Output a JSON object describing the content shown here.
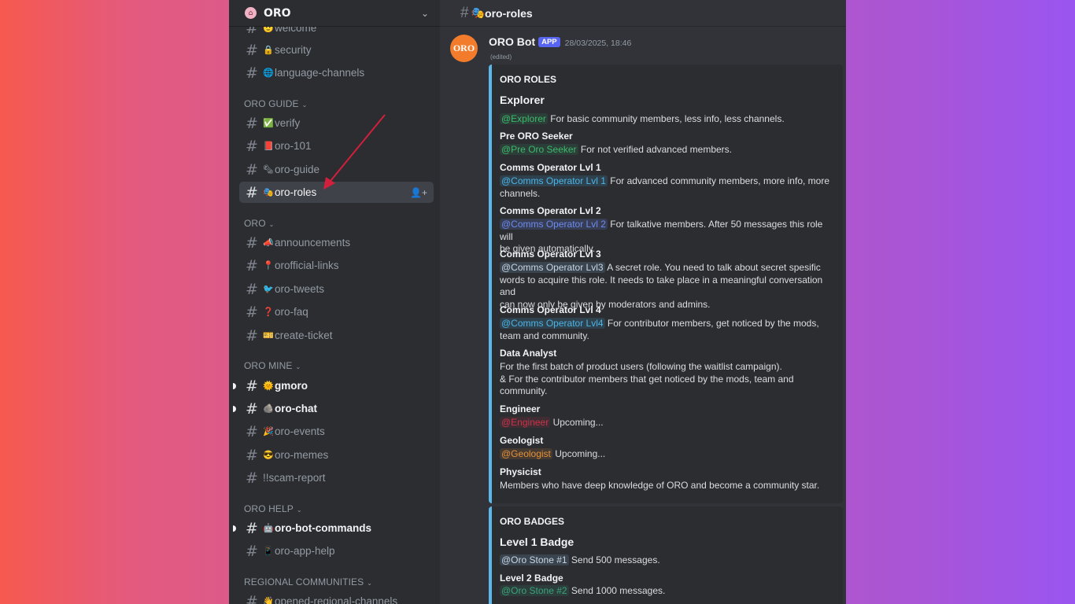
{
  "server": {
    "name": "ORO",
    "icon": "home-icon"
  },
  "sidebar": {
    "categories": [
      {
        "label": "ORO GUIDE"
      },
      {
        "label": "ORO"
      },
      {
        "label": "ORO MINE"
      },
      {
        "label": "ORO HELP"
      },
      {
        "label": "REGIONAL COMMUNITIES"
      }
    ],
    "channels": [
      {
        "emoji": "🫡",
        "name": "welcome"
      },
      {
        "emoji": "🔒",
        "name": "security"
      },
      {
        "emoji": "🌐",
        "name": "language-channels"
      },
      {
        "emoji": "✅",
        "name": "verify"
      },
      {
        "emoji": "📕",
        "name": "oro-101"
      },
      {
        "emoji": "🗞",
        "name": "oro-guide"
      },
      {
        "emoji": "🎭",
        "name": "oro-roles"
      },
      {
        "emoji": "📣",
        "name": "announcements"
      },
      {
        "emoji": "📍",
        "name": "orofficial-links"
      },
      {
        "emoji": "🐦",
        "name": "oro-tweets"
      },
      {
        "emoji": "❓",
        "name": "oro-faq"
      },
      {
        "emoji": "🎫",
        "name": "create-ticket"
      },
      {
        "emoji": "🌞",
        "name": "gmoro"
      },
      {
        "emoji": "🪨",
        "name": "oro-chat"
      },
      {
        "emoji": "🎉",
        "name": "oro-events"
      },
      {
        "emoji": "😎",
        "name": "oro-memes"
      },
      {
        "emoji": "",
        "name": "!!scam-report"
      },
      {
        "emoji": "🤖",
        "name": "oro-bot-commands"
      },
      {
        "emoji": "📱",
        "name": "oro-app-help"
      },
      {
        "emoji": "👋",
        "name": "opened-regional-channels"
      }
    ]
  },
  "header": {
    "channel": "oro-roles",
    "emoji": "🎭"
  },
  "message": {
    "author": "ORO Bot",
    "tag": "APP",
    "time": "28/03/2025, 18:46",
    "edited": "(edited)",
    "avatar_text": "ORO"
  },
  "roles_embed": {
    "title": "ORO ROLES",
    "explorer_h": "Explorer",
    "explorer_m": "@Explorer",
    "explorer_t": "For basic community members, less info, less channels.",
    "pre_h": "Pre ORO Seeker",
    "pre_m": "@Pre Oro Seeker",
    "pre_t": "For not verified advanced members.",
    "c1_h": "Comms Operator Lvl 1",
    "c1_m": "@Comms Operator Lvl 1",
    "c1_t": "For advanced community members, more info, more",
    "c1_t2": "channels.",
    "c2_h": "Comms Operator Lvl 2",
    "c2_m": "@Comms Operator Lvl 2",
    "c2_t": "For talkative members. After 50 messages this role will",
    "c2_t2": "be given automatically.",
    "c3_h": "Comms Operator Lvl 3",
    "c3_m": "@Comms Operator Lvl3",
    "c3_t": "A secret role. You need to talk about secret spesific",
    "c3_t2": "words to acquire this role. It needs to take place in a meaningful conversation and",
    "c3_t3": "can now only be given by moderators and admins.",
    "c4_h": "Comms Operator Lvl 4",
    "c4_m": "@Comms Operator Lvl4",
    "c4_t": "For contributor members, get noticed by the mods,",
    "c4_t2": "team and community.",
    "da_h": "Data Analyst",
    "da_t": "For the first batch of product users (following the waitlist campaign).",
    "da_t2": "& For the contributor members that get noticed by the mods, team and",
    "da_t3": "community.",
    "eng_h": "Engineer",
    "eng_m": "@Engineer",
    "eng_t": "Upcoming...",
    "geo_h": "Geologist",
    "geo_m": "@Geologist",
    "geo_t": "Upcoming...",
    "phy_h": "Physicist",
    "phy_t": "Members who have deep knowledge of ORO and become a community star."
  },
  "badges_embed": {
    "title": "ORO BADGES",
    "l1_h": "Level 1 Badge",
    "l1_m": "@Oro Stone #1",
    "l1_t": "Send 500 messages.",
    "l2_h": "Level 2 Badge",
    "l2_m": "@Oro Stone #2",
    "l2_t": "Send 1000 messages."
  },
  "colors": {
    "accent_blue": "#5bb7e8",
    "annotation_arrow": "#d21f3c",
    "avatar": "#f27c2c"
  }
}
